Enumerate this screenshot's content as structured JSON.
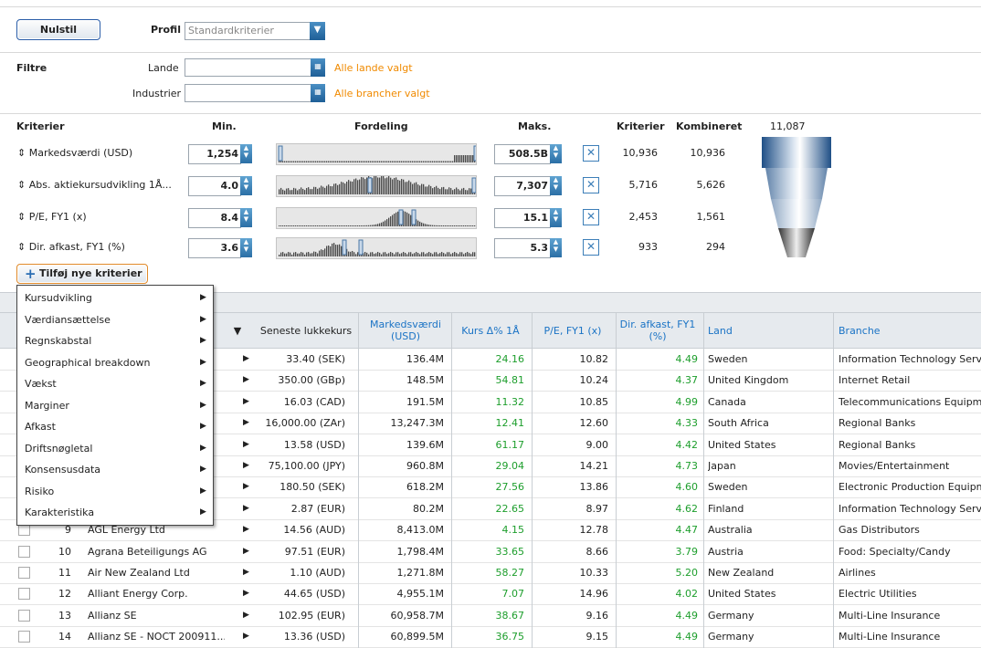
{
  "toolbar": {
    "reset_label": "Nulstil",
    "profile_label": "Profil",
    "profile_value": "Standardkriterier"
  },
  "filters": {
    "title": "Filtre",
    "countries_label": "Lande",
    "countries_status": "Alle lande valgt",
    "industries_label": "Industrier",
    "industries_status": "Alle brancher valgt"
  },
  "criteria_header": {
    "criteria": "Kriterier",
    "min": "Min.",
    "distribution": "Fordeling",
    "max": "Maks.",
    "count": "Kriterier",
    "combined": "Kombineret",
    "total": "11,087"
  },
  "criteria": [
    {
      "name": "Markedsværdi (USD)",
      "min": "1,254",
      "max": "508.5B",
      "count": "10,936",
      "combined": "10,936"
    },
    {
      "name": "Abs. aktiekursudvikling 1Å...",
      "min": "4.0",
      "max": "7,307",
      "count": "5,716",
      "combined": "5,626"
    },
    {
      "name": "P/E, FY1 (x)",
      "min": "8.4",
      "max": "15.1",
      "count": "2,453",
      "combined": "1,561"
    },
    {
      "name": "Dir. afkast, FY1 (%)",
      "min": "3.6",
      "max": "5.3",
      "count": "933",
      "combined": "294"
    }
  ],
  "add_criteria_label": "Tilføj nye kriterier",
  "menu": [
    "Kursudvikling",
    "Værdiansættelse",
    "Regnskabstal",
    "Geographical breakdown",
    "Vækst",
    "Marginer",
    "Afkast",
    "Driftsnøgletal",
    "Konsensusdata",
    "Risiko",
    "Karakteristika"
  ],
  "table": {
    "headers": {
      "close": "Seneste lukkekurs",
      "mcap": "Markedsværdi (USD)",
      "change": "Kurs Δ% 1Å",
      "pe": "P/E, FY1 (x)",
      "yield": "Dir. afkast, FY1 (%)",
      "country": "Land",
      "industry": "Branche"
    },
    "rows": [
      {
        "num": "",
        "name": "",
        "close": "33.40 (SEK)",
        "mcap": "136.4M",
        "change": "24.16",
        "pe": "10.82",
        "yield": "4.49",
        "country": "Sweden",
        "industry": "Information Technology Servic"
      },
      {
        "num": "",
        "name": "",
        "close": "350.00 (GBp)",
        "mcap": "148.5M",
        "change": "54.81",
        "pe": "10.24",
        "yield": "4.37",
        "country": "United Kingdom",
        "industry": "Internet Retail"
      },
      {
        "num": "",
        "name": "",
        "close": "16.03 (CAD)",
        "mcap": "191.5M",
        "change": "11.32",
        "pe": "10.85",
        "yield": "4.99",
        "country": "Canada",
        "industry": "Telecommunications Equipme"
      },
      {
        "num": "",
        "name": "",
        "close": "16,000.00 (ZAr)",
        "mcap": "13,247.3M",
        "change": "12.41",
        "pe": "12.60",
        "yield": "4.33",
        "country": "South Africa",
        "industry": "Regional Banks"
      },
      {
        "num": "",
        "name": "",
        "close": "13.58 (USD)",
        "mcap": "139.6M",
        "change": "61.17",
        "pe": "9.00",
        "yield": "4.42",
        "country": "United States",
        "industry": "Regional Banks"
      },
      {
        "num": "",
        "name": "",
        "close": "75,100.00 (JPY)",
        "mcap": "960.8M",
        "change": "29.04",
        "pe": "14.21",
        "yield": "4.73",
        "country": "Japan",
        "industry": "Movies/Entertainment"
      },
      {
        "num": "",
        "name": "",
        "close": "180.50 (SEK)",
        "mcap": "618.2M",
        "change": "27.56",
        "pe": "13.86",
        "yield": "4.60",
        "country": "Sweden",
        "industry": "Electronic Production Equipm"
      },
      {
        "num": "",
        "name": "",
        "close": "2.87 (EUR)",
        "mcap": "80.2M",
        "change": "22.65",
        "pe": "8.97",
        "yield": "4.62",
        "country": "Finland",
        "industry": "Information Technology Servic"
      },
      {
        "num": "9",
        "name": "AGL Energy Ltd",
        "close": "14.56 (AUD)",
        "mcap": "8,413.0M",
        "change": "4.15",
        "pe": "12.78",
        "yield": "4.47",
        "country": "Australia",
        "industry": "Gas Distributors"
      },
      {
        "num": "10",
        "name": "Agrana Beteiligungs AG",
        "close": "97.51 (EUR)",
        "mcap": "1,798.4M",
        "change": "33.65",
        "pe": "8.66",
        "yield": "3.79",
        "country": "Austria",
        "industry": "Food: Specialty/Candy"
      },
      {
        "num": "11",
        "name": "Air New Zealand Ltd",
        "close": "1.10 (AUD)",
        "mcap": "1,271.8M",
        "change": "58.27",
        "pe": "10.33",
        "yield": "5.20",
        "country": "New Zealand",
        "industry": "Airlines"
      },
      {
        "num": "12",
        "name": "Alliant Energy Corp.",
        "close": "44.65 (USD)",
        "mcap": "4,955.1M",
        "change": "7.07",
        "pe": "14.96",
        "yield": "4.02",
        "country": "United States",
        "industry": "Electric Utilities"
      },
      {
        "num": "13",
        "name": "Allianz SE",
        "close": "102.95 (EUR)",
        "mcap": "60,958.7M",
        "change": "38.67",
        "pe": "9.16",
        "yield": "4.49",
        "country": "Germany",
        "industry": "Multi-Line Insurance"
      },
      {
        "num": "14",
        "name": "Allianz SE - NOCT 200911...",
        "close": "13.36 (USD)",
        "mcap": "60,899.5M",
        "change": "36.75",
        "pe": "9.15",
        "yield": "4.49",
        "country": "Germany",
        "industry": "Multi-Line Insurance"
      }
    ]
  }
}
